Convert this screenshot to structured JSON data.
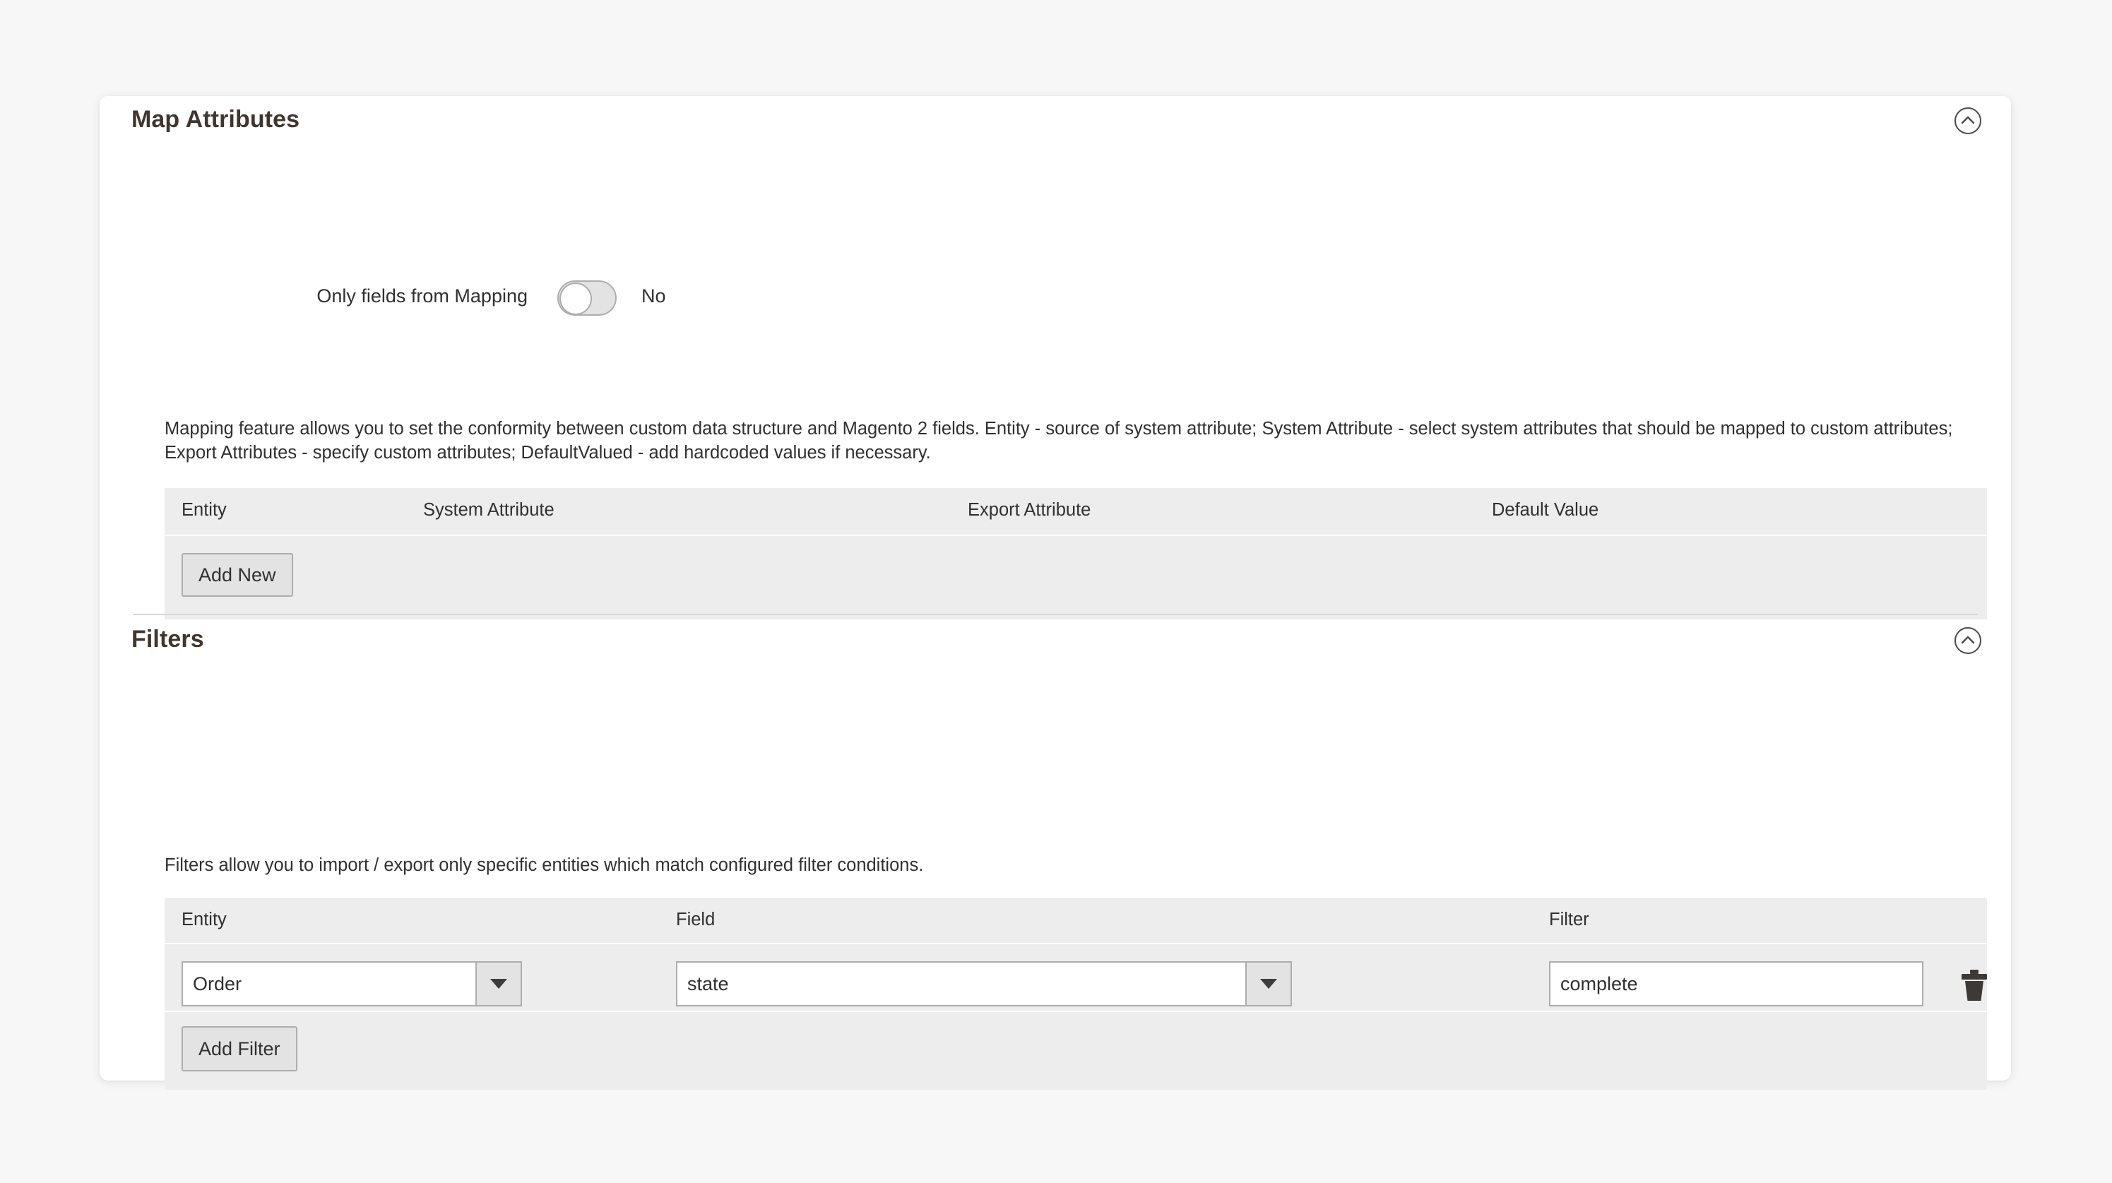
{
  "sections": {
    "map_attributes": {
      "title": "Map Attributes",
      "collapse_icon": "chevron-up-circle-icon",
      "toggle": {
        "label": "Only fields from Mapping",
        "value": "No",
        "state": "off"
      },
      "description": "Mapping feature allows you to set the conformity between custom data structure and Magento 2 fields. Entity - source of system attribute; System Attribute - select system attributes that should be mapped to custom attributes; Export Attributes - specify custom attributes; DefaultValued - add hardcoded values if necessary.",
      "table": {
        "headers": [
          "Entity",
          "System Attribute",
          "Export Attribute",
          "Default Value"
        ],
        "rows": []
      },
      "add_button": "Add New"
    },
    "filters": {
      "title": "Filters",
      "collapse_icon": "chevron-up-circle-icon",
      "description": "Filters allow you to import / export only specific entities which match configured filter conditions.",
      "table": {
        "headers": [
          "Entity",
          "Field",
          "Filter"
        ],
        "rows": [
          {
            "entity": "Order",
            "field": "state",
            "filter": "complete",
            "filter_placeholder": "",
            "delete_icon": "trash-icon"
          }
        ]
      },
      "add_button": "Add Filter"
    }
  },
  "colors": {
    "page_background": "#f7f7f7",
    "card_background": "#ffffff",
    "table_background": "#ededed",
    "button_background": "#e3e3e3",
    "border": "#adadad",
    "text": "#303030",
    "heading": "#41362f"
  }
}
